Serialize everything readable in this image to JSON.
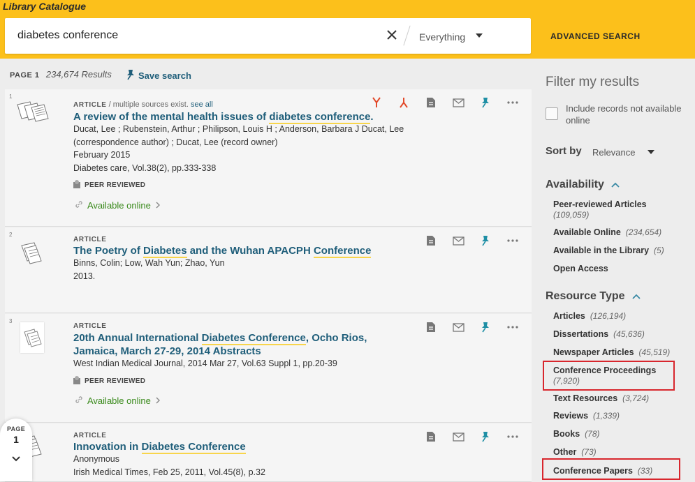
{
  "header": {
    "brand": "Library Catalogue",
    "search_value": "diabetes conference",
    "scope": "Everything",
    "advanced_search": "ADVANCED SEARCH"
  },
  "results_bar": {
    "page_label": "PAGE 1",
    "count": "234,674 Results",
    "save_search": "Save search"
  },
  "results": [
    {
      "num": "1",
      "type": "ARTICLE",
      "type_sub": " / multiple sources exist. ",
      "see_all": "see all",
      "title_parts": [
        "A review of the mental health issues of ",
        "diabetes conference",
        "."
      ],
      "meta": [
        "Ducat, Lee ; Rubenstein, Arthur ; Philipson, Louis H ; Anderson, Barbara J Ducat, Lee",
        "(correspondence author) ; Ducat, Lee (record owner)",
        "February 2015",
        "Diabetes care, Vol.38(2), pp.333-338"
      ],
      "peer": "PEER REVIEWED",
      "avail": "Available online"
    },
    {
      "num": "2",
      "type": "ARTICLE",
      "title_parts": [
        "The Poetry of ",
        "Diabetes",
        " and the Wuhan APACPH ",
        "Conference"
      ],
      "meta": [
        "Binns, Colin; Low, Wah Yun; Zhao, Yun",
        "2013."
      ]
    },
    {
      "num": "3",
      "type": "ARTICLE",
      "title_line1_parts": [
        "20th Annual International ",
        "Diabetes Conference",
        ", Ocho Rios,"
      ],
      "title_line2": "Jamaica, March 27-29, 2014 Abstracts",
      "meta": [
        "West Indian Medical Journal, 2014 Mar 27, Vol.63 Suppl 1, pp.20-39"
      ],
      "peer": "PEER REVIEWED",
      "avail": "Available online"
    },
    {
      "num": "",
      "type": "ARTICLE",
      "title_parts": [
        "Innovation in ",
        "Diabetes Conference"
      ],
      "meta": [
        "Anonymous",
        "Irish Medical Times, Feb 25, 2011, Vol.45(8), p.32"
      ]
    }
  ],
  "page_indicator": {
    "label": "PAGE",
    "number": "1"
  },
  "sidebar": {
    "title": "Filter my results",
    "include_label": "Include records not available online",
    "sort_label": "Sort by",
    "sort_value": "Relevance",
    "availability": {
      "heading": "Availability",
      "items": [
        {
          "label": "Peer-reviewed Articles",
          "count": "(109,059)"
        },
        {
          "label": "Available Online",
          "count": "(234,654)"
        },
        {
          "label": "Available in the Library",
          "count": "(5)"
        },
        {
          "label": "Open Access",
          "count": ""
        }
      ]
    },
    "resource_type": {
      "heading": "Resource Type",
      "items": [
        {
          "label": "Articles",
          "count": "(126,194)"
        },
        {
          "label": "Dissertations",
          "count": "(45,636)"
        },
        {
          "label": "Newspaper Articles",
          "count": "(45,519)"
        },
        {
          "label": "Conference Proceedings",
          "count": "(7,920)"
        },
        {
          "label": "Text Resources",
          "count": "(3,724)"
        },
        {
          "label": "Reviews",
          "count": "(1,339)"
        },
        {
          "label": "Books",
          "count": "(78)"
        },
        {
          "label": "Other",
          "count": "(73)"
        },
        {
          "label": "Conference Papers",
          "count": "(33)"
        }
      ]
    }
  },
  "colors": {
    "header": "#fcc01b",
    "link": "#1f5e7a",
    "available": "#3a8a1c",
    "highlight_box": "#d8262d"
  }
}
